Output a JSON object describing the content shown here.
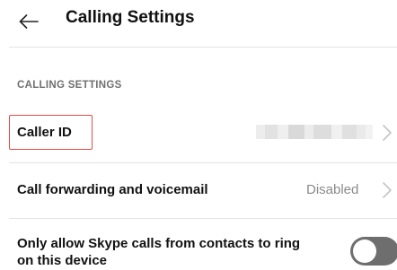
{
  "header": {
    "back_icon": "back-arrow-icon",
    "title": "Calling Settings"
  },
  "section": {
    "title": "CALLING SETTINGS"
  },
  "rows": [
    {
      "label": "Caller ID",
      "value": "",
      "value_blurred": true,
      "chevron_icon": "chevron-right-icon",
      "highlighted": true,
      "highlight_color": "#e34a4a"
    },
    {
      "label": "Call forwarding and voicemail",
      "value": "Disabled",
      "chevron_icon": "chevron-right-icon"
    },
    {
      "label_line1": "Only allow Skype calls from contacts to ring",
      "label_line2": "on this device",
      "toggle_on": false,
      "toggle_color": "#6e6e6e"
    }
  ]
}
